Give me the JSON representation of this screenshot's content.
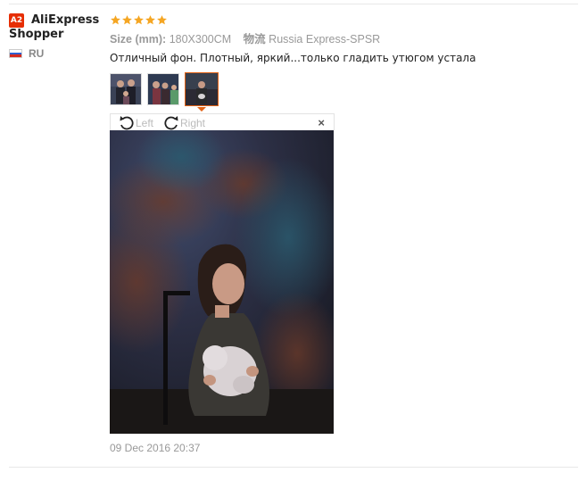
{
  "user": {
    "badge": "A2",
    "name_line1": "AliExpress",
    "name_line2": "Shopper",
    "country": "RU",
    "flag_colors": [
      "#ffffff",
      "#2f5fd0",
      "#d52b1e"
    ]
  },
  "review": {
    "rating": 5,
    "star_color": "#f5a623",
    "size_label": "Size (mm):",
    "size_value": "180X300CM",
    "shipping_label": "物流",
    "shipping_value": "Russia Express-SPSR",
    "comment": "Отличный фон. Плотный, яркий...только гладить утюгом устала",
    "date": "09 Dec 2016 20:37"
  },
  "thumbnails": [
    {
      "name": "photo-thumb-1",
      "selected": false
    },
    {
      "name": "photo-thumb-2",
      "selected": false
    },
    {
      "name": "photo-thumb-3",
      "selected": true
    }
  ],
  "viewer": {
    "rotate_left_label": "Left",
    "rotate_right_label": "Right",
    "close_symbol": "×",
    "accent": "#e46315"
  }
}
